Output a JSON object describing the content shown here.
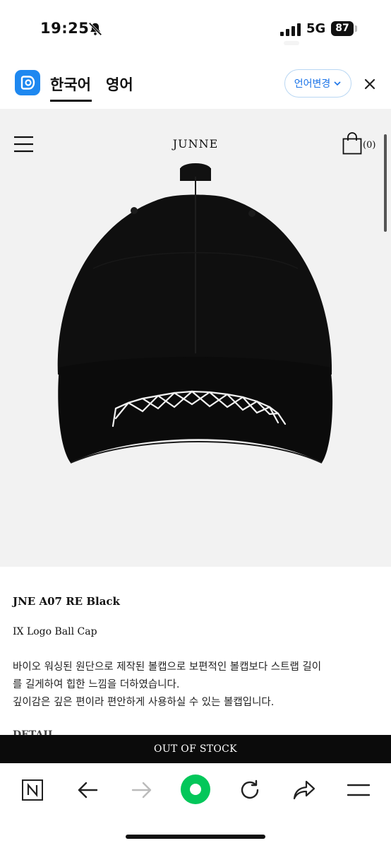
{
  "status_bar": {
    "time": "19:25",
    "network": "5G",
    "battery": "87"
  },
  "translate_bar": {
    "tab_korean": "한국어",
    "tab_english": "영어",
    "change_language": "언어변경"
  },
  "site": {
    "brand": "JUNNE",
    "cart_count": "(0)"
  },
  "product": {
    "name": "JNE A07 RE Black",
    "subtitle": "IX Logo Ball Cap",
    "description": [
      "바이오 워싱된 원단으로 제작된 볼캡으로 보편적인 볼캡보다 스트랩 길이",
      "를 길게하여 힙한 느낌을 더하였습니다.",
      "깊이감은 깊은 편이라 편안하게 사용하실 수 있는 볼캡입니다."
    ],
    "detail_heading": "DETAIL",
    "stock_status": "OUT OF STOCK"
  },
  "icons": {
    "status": [
      "bell-muted-icon",
      "signal-icon"
    ],
    "translate": [
      "translate-app-icon",
      "chevron-down-icon",
      "close-icon"
    ],
    "site": [
      "menu-icon",
      "shopping-bag-icon"
    ],
    "toolbar": [
      "naver-n-icon",
      "back-arrow-icon",
      "forward-arrow-icon",
      "green-dot-home-icon",
      "reload-icon",
      "share-icon",
      "hamburger-menu-icon"
    ]
  },
  "colors": {
    "accent_blue": "#1a73e8",
    "app_logo_blue": "#1e88f0",
    "green_home": "#03c75a",
    "stock_bar": "#0b0b0b",
    "hero_bg": "#f2f2f2"
  }
}
